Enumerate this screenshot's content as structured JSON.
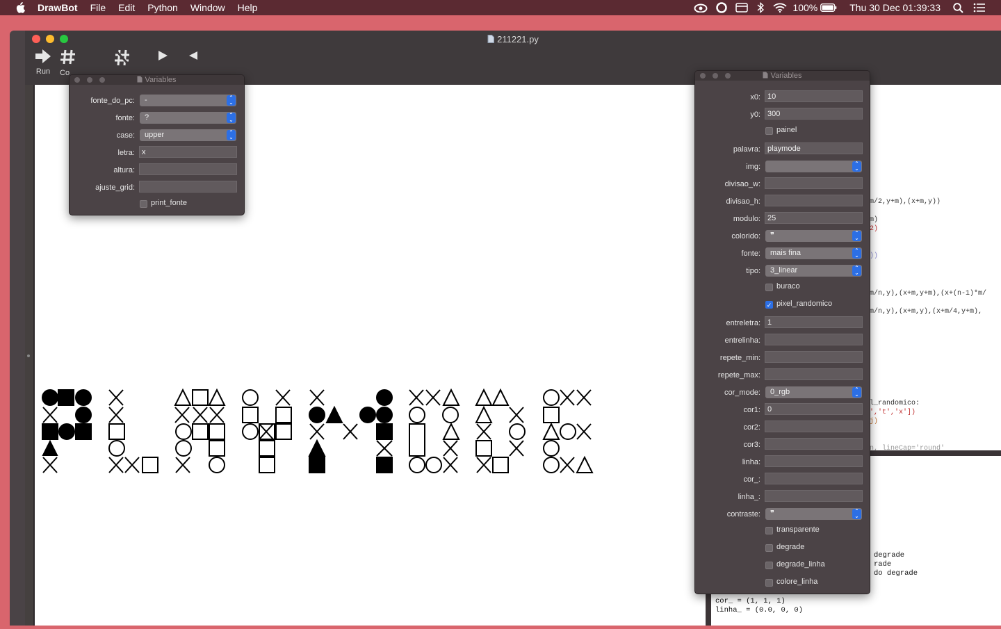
{
  "menubar": {
    "app": "DrawBot",
    "items": [
      "File",
      "Edit",
      "Python",
      "Window",
      "Help"
    ],
    "battery": "100%",
    "datetime": "Thu 30 Dec  01:39:33"
  },
  "window": {
    "title": "211221.py",
    "toolbar": {
      "run_label": "Run",
      "comment_label": "Co"
    }
  },
  "left_panel": {
    "title": "Variables",
    "fields": {
      "fonte_do_pc": {
        "label": "fonte_do_pc:",
        "value": "-"
      },
      "fonte": {
        "label": "fonte:",
        "value": "?"
      },
      "case": {
        "label": "case:",
        "value": "upper"
      },
      "letra": {
        "label": "letra:",
        "value": "x"
      },
      "altura": {
        "label": "altura:",
        "value": ""
      },
      "ajuste_grid": {
        "label": "ajuste_grid:",
        "value": ""
      },
      "print_fonte": {
        "label": "print_fonte",
        "checked": false
      }
    }
  },
  "right_panel": {
    "title": "Variables",
    "fields": {
      "x0": {
        "label": "x0:",
        "value": "10"
      },
      "y0": {
        "label": "y0:",
        "value": "300"
      },
      "painel": {
        "label": "painel",
        "checked": false
      },
      "palavra": {
        "label": "palavra:",
        "value": "playmode"
      },
      "img": {
        "label": "img:",
        "value": ""
      },
      "divisao_w": {
        "label": "divisao_w:",
        "value": ""
      },
      "divisao_h": {
        "label": "divisao_h:",
        "value": ""
      },
      "modulo": {
        "label": "modulo:",
        "value": "25"
      },
      "colorido": {
        "label": "colorido:",
        "value": "❞"
      },
      "fonte": {
        "label": "fonte:",
        "value": "mais fina"
      },
      "tipo": {
        "label": "tipo:",
        "value": "3_linear"
      },
      "buraco": {
        "label": "buraco",
        "checked": false
      },
      "pixel_randomico": {
        "label": "pixel_randomico",
        "checked": true
      },
      "entreletra": {
        "label": "entreletra:",
        "value": "1"
      },
      "entrelinha": {
        "label": "entrelinha:",
        "value": ""
      },
      "repete_min": {
        "label": "repete_min:",
        "value": ""
      },
      "repete_max": {
        "label": "repete_max:",
        "value": ""
      },
      "cor_mode": {
        "label": "cor_mode:",
        "value": "0_rgb"
      },
      "cor1": {
        "label": "cor1:",
        "value": "0"
      },
      "cor2": {
        "label": "cor2:",
        "value": ""
      },
      "cor3": {
        "label": "cor3:",
        "value": ""
      },
      "linha": {
        "label": "linha:",
        "value": ""
      },
      "cor_": {
        "label": "cor_:",
        "value": ""
      },
      "linha_": {
        "label": "linha_:",
        "value": ""
      },
      "contraste": {
        "label": "contraste:",
        "value": "❞"
      },
      "transparente": {
        "label": "transparente",
        "checked": false
      },
      "degrade": {
        "label": "degrade",
        "checked": false
      },
      "degrade_linha": {
        "label": "degrade_linha",
        "checked": false
      },
      "colore_linha": {
        "label": "colore_linha",
        "checked": false
      }
    }
  },
  "code_lines": [
    "m/2,y+m),(x+m,y))",
    "m)",
    "2)",
    "))",
    "m/n,y),(x+m,y+m),(x+(n-1)*m/",
    "m/n,y),(x+m,y),(x+m/4,y+m),",
    "l_randomico:",
    "','t','x'])",
    "j)",
    "n, lineCap='round'"
  ],
  "output_lines": [
    "degrade",
    "rade",
    "do degrade",
    "cor_ = (1, 1, 1)",
    "linha_ = (0.0, 0, 0)"
  ]
}
